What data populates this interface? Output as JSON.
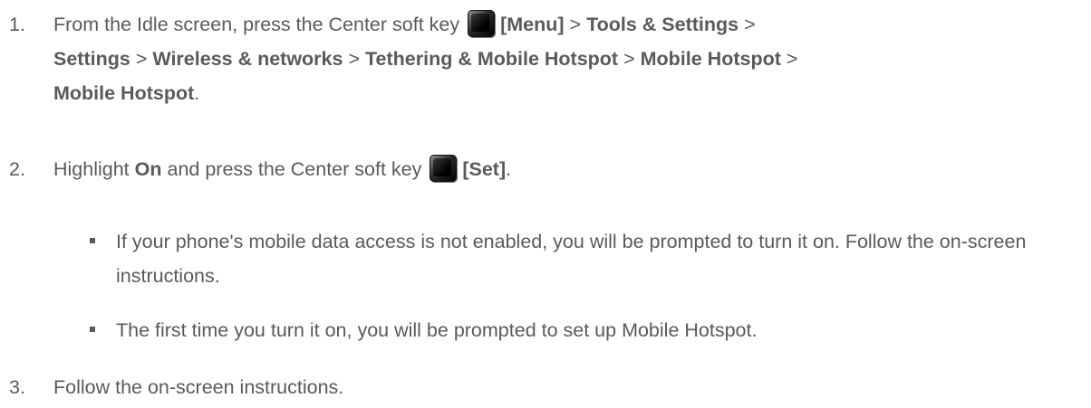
{
  "steps": [
    {
      "number": "1.",
      "text_a": "From the Idle screen, press the Center soft key",
      "key_label": "[Menu]",
      "sep": ">",
      "tools_settings": "Tools & Settings",
      "settings": "Settings",
      "wireless": "Wireless & networks",
      "tethering": "Tethering & Mobile Hotspot",
      "mobile_hotspot": "Mobile Hotspot",
      "end": "."
    },
    {
      "number": "2.",
      "text_a": "Highlight",
      "on": "On",
      "text_b": "and press the Center soft key",
      "key_label": "[Set]",
      "end": "."
    },
    {
      "number": "3.",
      "text": "Follow the on-screen instructions."
    }
  ],
  "bullets": [
    "If your phone's mobile data access is not enabled, you will be prompted to turn it on. Follow the on-screen instructions.",
    "The first time you turn it on, you will be prompted to set up Mobile Hotspot."
  ],
  "icons": {
    "center_soft_key": "center-soft-key-icon"
  }
}
